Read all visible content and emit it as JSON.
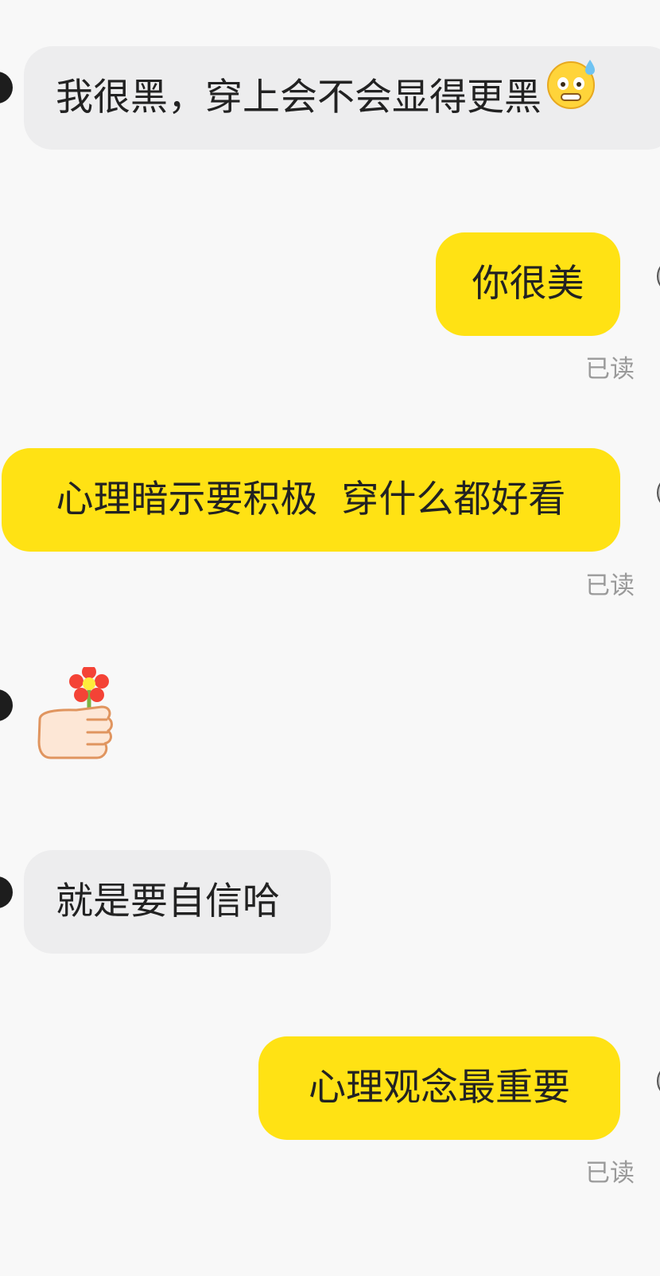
{
  "messages": [
    {
      "id": 1,
      "side": "left",
      "text": "我很黑，穿上会不会显得更黑",
      "emoji": "anxious-sweat-face-emoji"
    },
    {
      "id": 2,
      "side": "right",
      "text": "你很美",
      "status": "已读"
    },
    {
      "id": 3,
      "side": "right",
      "text": "心理暗示要积极  穿什么都好看",
      "status": "已读"
    },
    {
      "id": 4,
      "side": "left",
      "sticker": "thumb-with-flower-emoji"
    },
    {
      "id": 5,
      "side": "left",
      "text": "就是要自信哈"
    },
    {
      "id": 6,
      "side": "right",
      "text": "心理观念最重要",
      "status": "已读"
    }
  ],
  "colors": {
    "background": "#f8f8f8",
    "incoming_bubble": "#ededee",
    "outgoing_bubble": "#ffe214",
    "text": "#222222",
    "status_text": "#9a9a9a"
  }
}
